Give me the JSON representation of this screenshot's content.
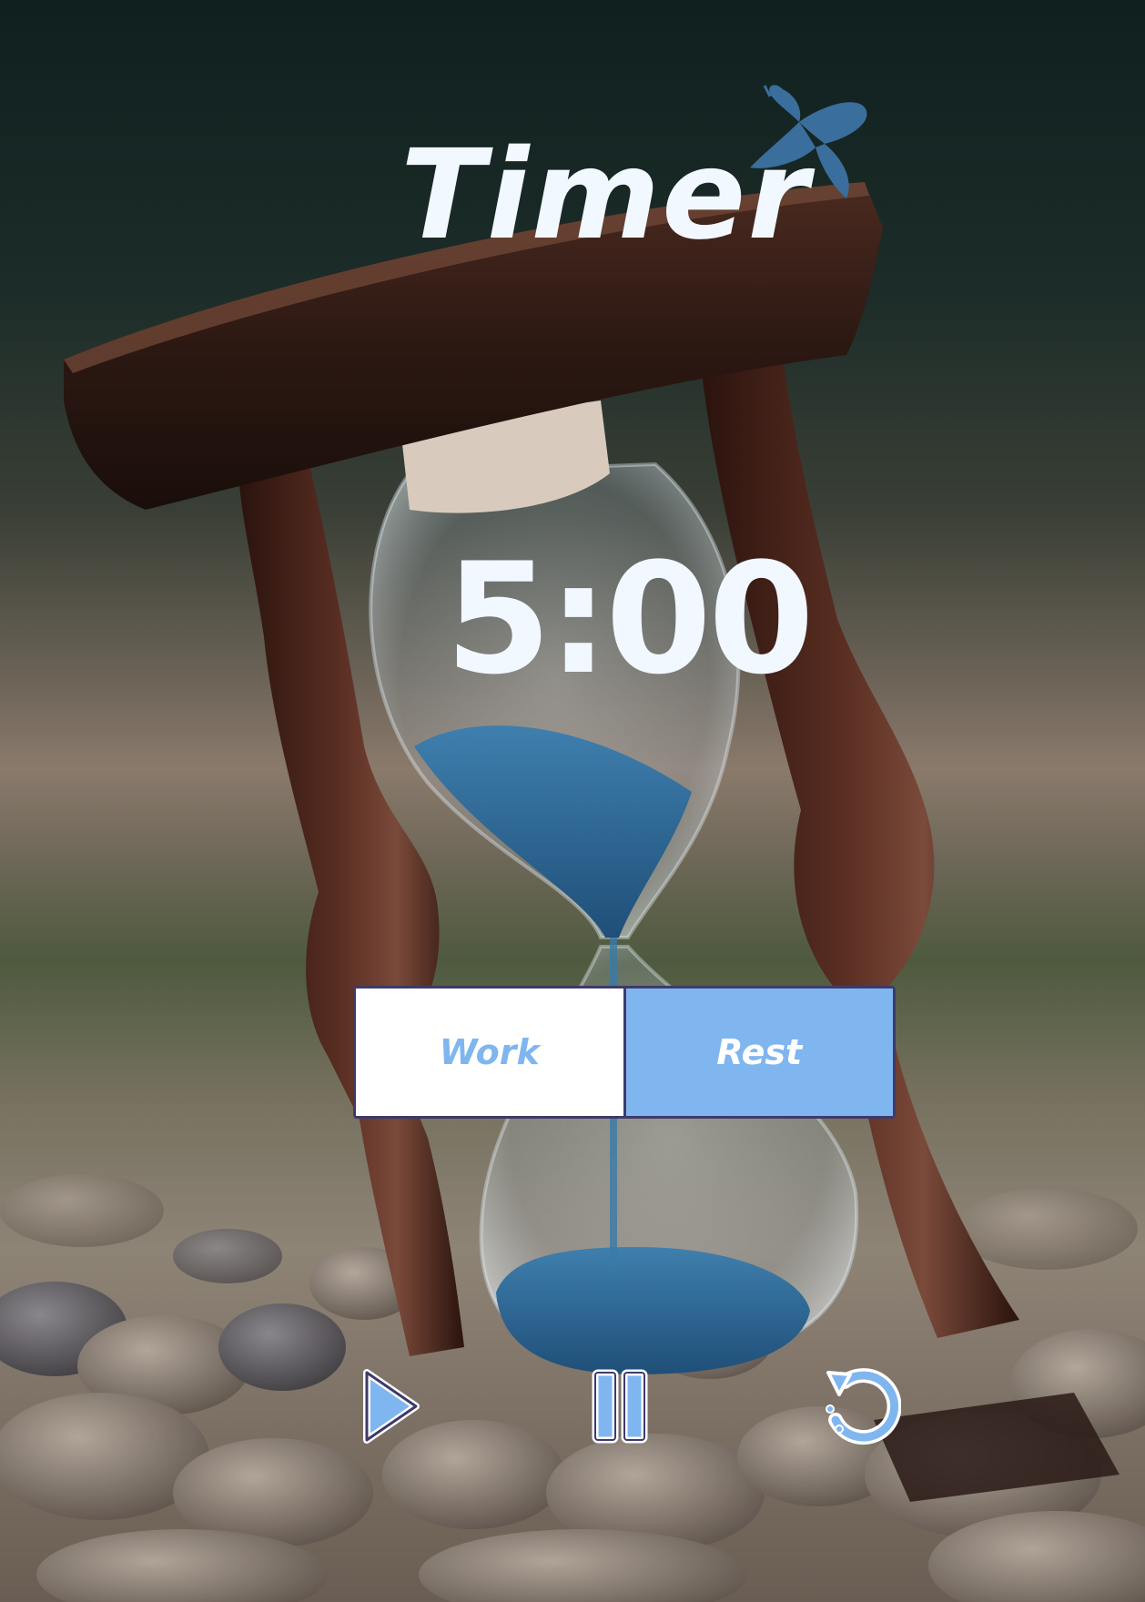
{
  "app": {
    "title": "Timer"
  },
  "timer": {
    "display": "5:00"
  },
  "modes": {
    "work_label": "Work",
    "rest_label": "Rest",
    "selected": "Rest"
  },
  "controls": {
    "play_icon": "play-icon",
    "pause_icon": "pause-icon",
    "reset_icon": "reset-icon"
  },
  "colors": {
    "accent": "#80b6f0",
    "accent_text": "#7fb6ef",
    "title_text": "#f2f8ff",
    "toggle_border": "#3e3a6a",
    "butterfly": "#3a6e9c"
  }
}
